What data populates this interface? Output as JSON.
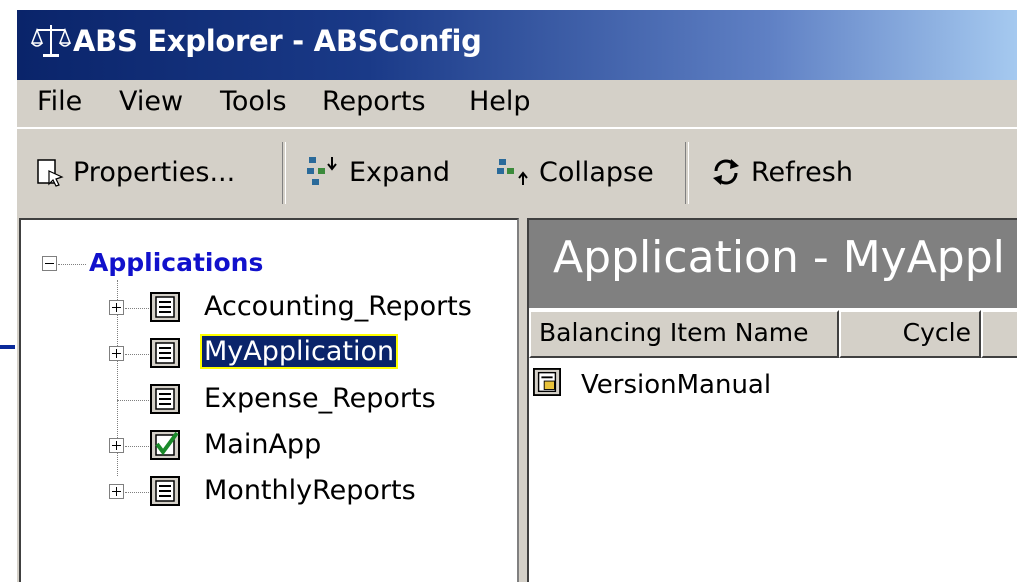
{
  "window": {
    "title": "ABS Explorer - ABSConfig",
    "app_icon": "scales-icon"
  },
  "menu": [
    "File",
    "View",
    "Tools",
    "Reports",
    "Help"
  ],
  "toolbar": {
    "properties": {
      "label": "Properties...",
      "icon": "properties-icon"
    },
    "expand": {
      "label": "Expand",
      "icon": "expand-tree-icon"
    },
    "collapse": {
      "label": "Collapse",
      "icon": "collapse-tree-icon"
    },
    "refresh": {
      "label": "Refresh",
      "icon": "refresh-icon"
    }
  },
  "tree": {
    "root": "Applications",
    "items": [
      {
        "label": "Accounting_Reports",
        "expandable": true,
        "icon": "application-icon"
      },
      {
        "label": "MyApplication",
        "expandable": true,
        "icon": "application-icon",
        "selected": true
      },
      {
        "label": "Expense_Reports",
        "expandable": false,
        "icon": "application-icon"
      },
      {
        "label": "MainApp",
        "expandable": true,
        "icon": "checked-application-icon"
      },
      {
        "label": "MonthlyReports",
        "expandable": true,
        "icon": "application-icon"
      }
    ]
  },
  "detail": {
    "title": "Application - MyAppl",
    "columns": [
      "Balancing Item Name",
      "Cycle"
    ],
    "rows": [
      {
        "name": "VersionManual",
        "icon": "balancing-item-icon"
      }
    ]
  },
  "colors": {
    "title_bar": "#0a246a",
    "selection": "#0a246a",
    "selection_outline": "#ffff00",
    "root_label": "#1111cc",
    "pointer_arrow": "#0a2a9a"
  }
}
